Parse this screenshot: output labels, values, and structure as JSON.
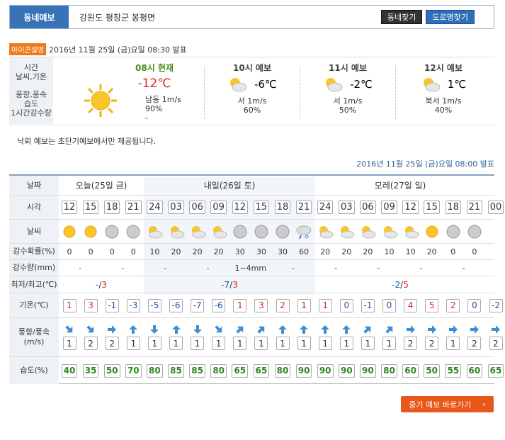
{
  "header": {
    "tab": "동네예보",
    "location": "강원도 평창군 봉평면",
    "btn_find": "동네찾기",
    "btn_road": "도로명찾기"
  },
  "issue": {
    "icon_label": "아이콘설명",
    "text": "2016년 11월 25일 (금)요일 08:30 발표"
  },
  "current": {
    "labels": [
      "시간",
      "날씨,기온",
      "풍향,풍속",
      "습도",
      "1시간강수량"
    ],
    "time": "08시 현재",
    "temp": "-12℃",
    "wind": "남동 1m/s",
    "humidity": "90%",
    "rain": "-",
    "forecasts": [
      {
        "time": "10시 예보",
        "temp": "-6℃",
        "wind": "서 1m/s",
        "humidity": "60%"
      },
      {
        "time": "11시 예보",
        "temp": "-2℃",
        "wind": "서 1m/s",
        "humidity": "50%"
      },
      {
        "time": "12시 예보",
        "temp": "1℃",
        "wind": "북서 1m/s",
        "humidity": "40%"
      }
    ]
  },
  "note": "낙뢰 예보는 초단기예보에서만 제공됩니다.",
  "issue2": "2016년 11월 25일 (금)요일 08:00 발표",
  "grid": {
    "labels": {
      "date": "날짜",
      "time": "시각",
      "weather": "날씨",
      "pop": "강수확률(%)",
      "rain": "강수량(mm)",
      "minmax": "최저/최고(℃)",
      "temp": "기온(℃)",
      "wind": "풍향/풍속(m/s)",
      "hum": "습도(%)"
    },
    "days": [
      {
        "label": "오늘(25일 금)"
      },
      {
        "label": "내일(26일 토)"
      },
      {
        "label": "모레(27일 일)"
      }
    ],
    "hours": [
      "12",
      "15",
      "18",
      "21",
      "24",
      "03",
      "06",
      "09",
      "12",
      "15",
      "18",
      "21",
      "24",
      "03",
      "06",
      "09",
      "12",
      "15",
      "18",
      "21",
      "00"
    ],
    "pop": [
      "0",
      "0",
      "0",
      "0",
      "10",
      "20",
      "20",
      "20",
      "30",
      "30",
      "30",
      "60",
      "20",
      "20",
      "20",
      "10",
      "10",
      "20",
      "0",
      "0"
    ],
    "rain": [
      {
        "v": "-"
      },
      {
        "v": "-"
      },
      {
        "v": "-"
      },
      {
        "v": "-"
      },
      {
        "v": "1~4mm"
      },
      {
        "v": "-"
      },
      {
        "v": "-"
      },
      {
        "v": "-"
      },
      {
        "v": "-"
      },
      {
        "v": "-"
      }
    ],
    "minmax": [
      {
        "min": "-",
        "max": "3"
      },
      {
        "min": "-7",
        "max": "3"
      },
      {
        "min": "-2",
        "max": "5"
      }
    ],
    "temps": [
      "1",
      "3",
      "-1",
      "-3",
      "-5",
      "-6",
      "-7",
      "-6",
      "1",
      "3",
      "2",
      "1",
      "1",
      "0",
      "-1",
      "0",
      "4",
      "5",
      "2",
      "0",
      "-2"
    ],
    "winds": [
      "1",
      "2",
      "2",
      "1",
      "1",
      "1",
      "1",
      "1",
      "1",
      "1",
      "1",
      "1",
      "1",
      "1",
      "1",
      "1",
      "2",
      "2",
      "1",
      "2",
      "2"
    ],
    "hums": [
      "40",
      "35",
      "50",
      "70",
      "80",
      "85",
      "85",
      "80",
      "65",
      "65",
      "80",
      "90",
      "90",
      "90",
      "90",
      "80",
      "60",
      "50",
      "55",
      "60",
      "65"
    ]
  },
  "mid_button": "중기 예보 바로가기"
}
